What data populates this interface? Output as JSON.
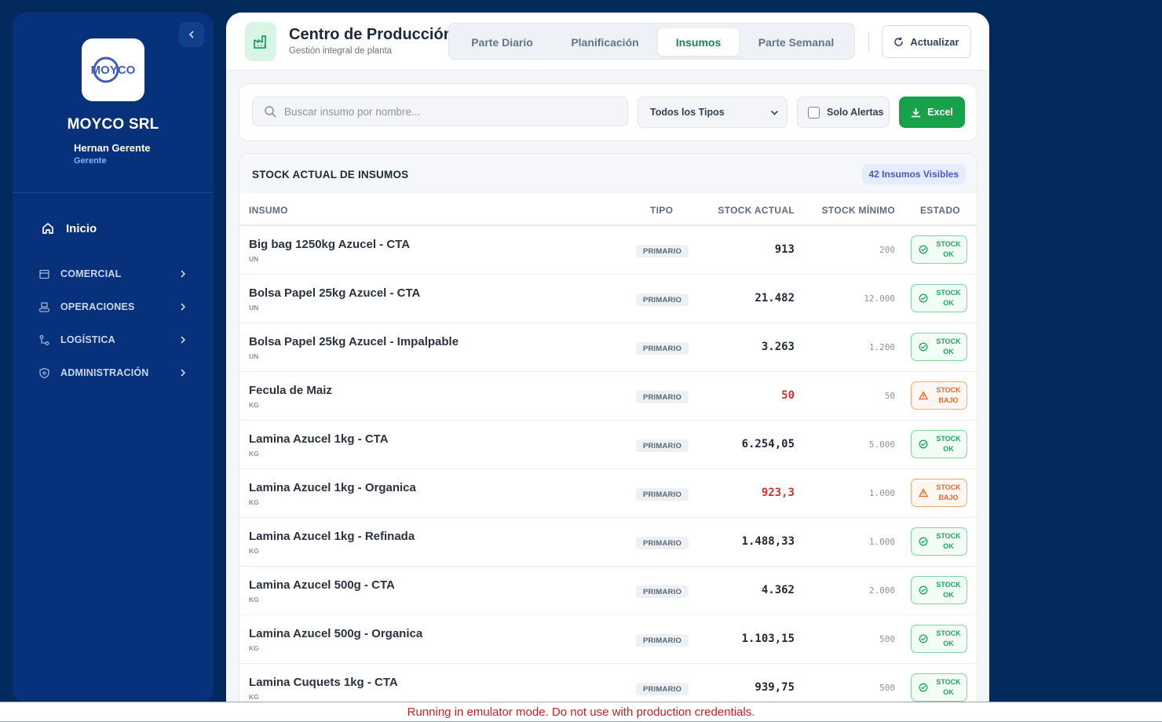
{
  "sidebar": {
    "logo_text": "MOYCO",
    "company": "MOYCO SRL",
    "user_name": "Hernan Gerente",
    "user_role": "Gerente",
    "home_label": "Inicio",
    "sections": [
      {
        "label": "COMERCIAL",
        "icon": "store-icon"
      },
      {
        "label": "OPERACIONES",
        "icon": "conveyor-icon"
      },
      {
        "label": "LOGÍSTICA",
        "icon": "route-icon"
      },
      {
        "label": "ADMINISTRACIÓN",
        "icon": "settings-shield-icon"
      }
    ]
  },
  "header": {
    "title": "Centro de Producción",
    "subtitle": "Gestión integral de planta",
    "tabs": [
      {
        "label": "Parte Diario",
        "active": false
      },
      {
        "label": "Planificación",
        "active": false
      },
      {
        "label": "Insumos",
        "active": true
      },
      {
        "label": "Parte Semanal",
        "active": false
      }
    ],
    "refresh_label": "Actualizar"
  },
  "filters": {
    "search_placeholder": "Buscar insumo por nombre...",
    "type_selected": "Todos los Tipos",
    "alerts_label": "Solo Alertas",
    "alerts_checked": false,
    "excel_label": "Excel"
  },
  "table": {
    "title": "STOCK ACTUAL DE INSUMOS",
    "count_badge": "42 Insumos Visibles",
    "columns": [
      "INSUMO",
      "TIPO",
      "STOCK ACTUAL",
      "STOCK MÍNIMO",
      "ESTADO"
    ],
    "rows": [
      {
        "name": "Big bag 1250kg Azucel - CTA",
        "unit": "UN",
        "type": "PRIMARIO",
        "stock": "913",
        "min": "200",
        "status": "STOCK OK",
        "low": false
      },
      {
        "name": "Bolsa Papel 25kg Azucel - CTA",
        "unit": "UN",
        "type": "PRIMARIO",
        "stock": "21.482",
        "min": "12.000",
        "status": "STOCK OK",
        "low": false
      },
      {
        "name": "Bolsa Papel 25kg Azucel - Impalpable",
        "unit": "UN",
        "type": "PRIMARIO",
        "stock": "3.263",
        "min": "1.200",
        "status": "STOCK OK",
        "low": false
      },
      {
        "name": "Fecula de Maiz",
        "unit": "KG",
        "type": "PRIMARIO",
        "stock": "50",
        "min": "50",
        "status": "STOCK BAJO",
        "low": true
      },
      {
        "name": "Lamina Azucel 1kg - CTA",
        "unit": "KG",
        "type": "PRIMARIO",
        "stock": "6.254,05",
        "min": "5.000",
        "status": "STOCK OK",
        "low": false
      },
      {
        "name": "Lamina Azucel 1kg - Organica",
        "unit": "KG",
        "type": "PRIMARIO",
        "stock": "923,3",
        "min": "1.000",
        "status": "STOCK BAJO",
        "low": true
      },
      {
        "name": "Lamina Azucel 1kg - Refinada",
        "unit": "KG",
        "type": "PRIMARIO",
        "stock": "1.488,33",
        "min": "1.000",
        "status": "STOCK OK",
        "low": false
      },
      {
        "name": "Lamina Azucel 500g - CTA",
        "unit": "KG",
        "type": "PRIMARIO",
        "stock": "4.362",
        "min": "2.000",
        "status": "STOCK OK",
        "low": false
      },
      {
        "name": "Lamina Azucel 500g - Organica",
        "unit": "KG",
        "type": "PRIMARIO",
        "stock": "1.103,15",
        "min": "500",
        "status": "STOCK OK",
        "low": false
      },
      {
        "name": "Lamina Cuquets 1kg - CTA",
        "unit": "KG",
        "type": "PRIMARIO",
        "stock": "939,75",
        "min": "500",
        "status": "STOCK OK",
        "low": false
      }
    ]
  },
  "emulator_notice": "Running in emulator mode. Do not use with production credentials.",
  "colors": {
    "sidebar_bg": "#07317a",
    "page_bg": "#022a5c",
    "accent_green": "#17a14a",
    "ok_green": "#1ea65a",
    "warn_orange": "#e8692a",
    "low_red": "#d32f2f"
  }
}
